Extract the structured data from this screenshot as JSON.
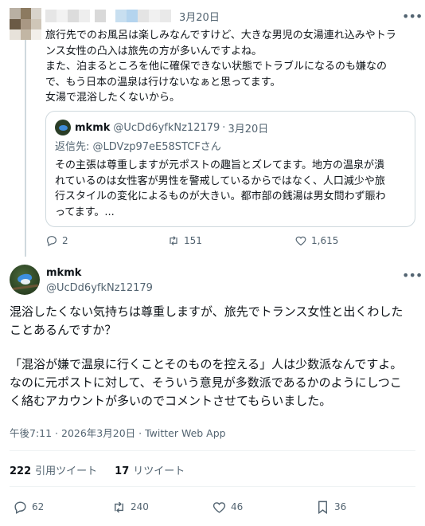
{
  "parent_tweet": {
    "date": "3月20日",
    "body_lines": [
      "旅行先でのお風呂は楽しみなんですけど、大きな男児の女湯連れ込みやトラ",
      "ンス女性の凸入は旅先の方が多いんですよね。",
      "また、泊まるところを他に確保できない状態でトラブルになるのも嫌なの",
      "で、もう日本の温泉は行けないなぁと思ってます。",
      "女湯で混浴したくないから。"
    ],
    "quote": {
      "name": "mkmk",
      "handle": "@UcDd6yfkNz12179",
      "separator": "·",
      "date": "3月20日",
      "reply_label": "返信先: ",
      "reply_handle": "@LDVzp97eE58STCFさん",
      "text_lines": [
        "その主張は尊重しますが元ポストの趣旨とズレてます。地方の温泉が潰",
        "れているのは女性客が男性を警戒しているからではなく、人口減少や旅",
        "行スタイルの変化によるものが大きい。都市部の銭湯は男女問わず賑わ",
        "ってます。..."
      ]
    },
    "actions": {
      "replies": "2",
      "retweets": "151",
      "likes": "1,615"
    }
  },
  "main_tweet": {
    "name": "mkmk",
    "handle": "@UcDd6yfkNz12179",
    "body_para1": [
      "混浴したくない気持ちは尊重しますが、旅先でトランス女性と出くわした",
      "ことあるんですか？"
    ],
    "body_para2": [
      "「混浴が嫌で温泉に行くことそのものを控える」人は少数派なんですよ。",
      "なのに元ポストに対して、そういう意見が多数派であるかのようにしつこ",
      "く絡むアカウントが多いのでコメントさせてもらいました。"
    ],
    "meta": "午後7:11 · 2026年3月20日 · Twitter Web App",
    "stats": {
      "quote_count": "222",
      "quote_label": "引用ツイート",
      "retweet_count": "17",
      "retweet_label": "リツイート"
    },
    "actions": {
      "replies": "62",
      "retweets": "240",
      "likes": "46",
      "bookmarks": "36"
    }
  },
  "icons": [
    "more-icon",
    "reply-icon",
    "retweet-icon",
    "like-icon",
    "bookmark-icon"
  ],
  "colors": {
    "text": "#0f1419",
    "muted": "#536471",
    "border": "#cfd9de"
  }
}
